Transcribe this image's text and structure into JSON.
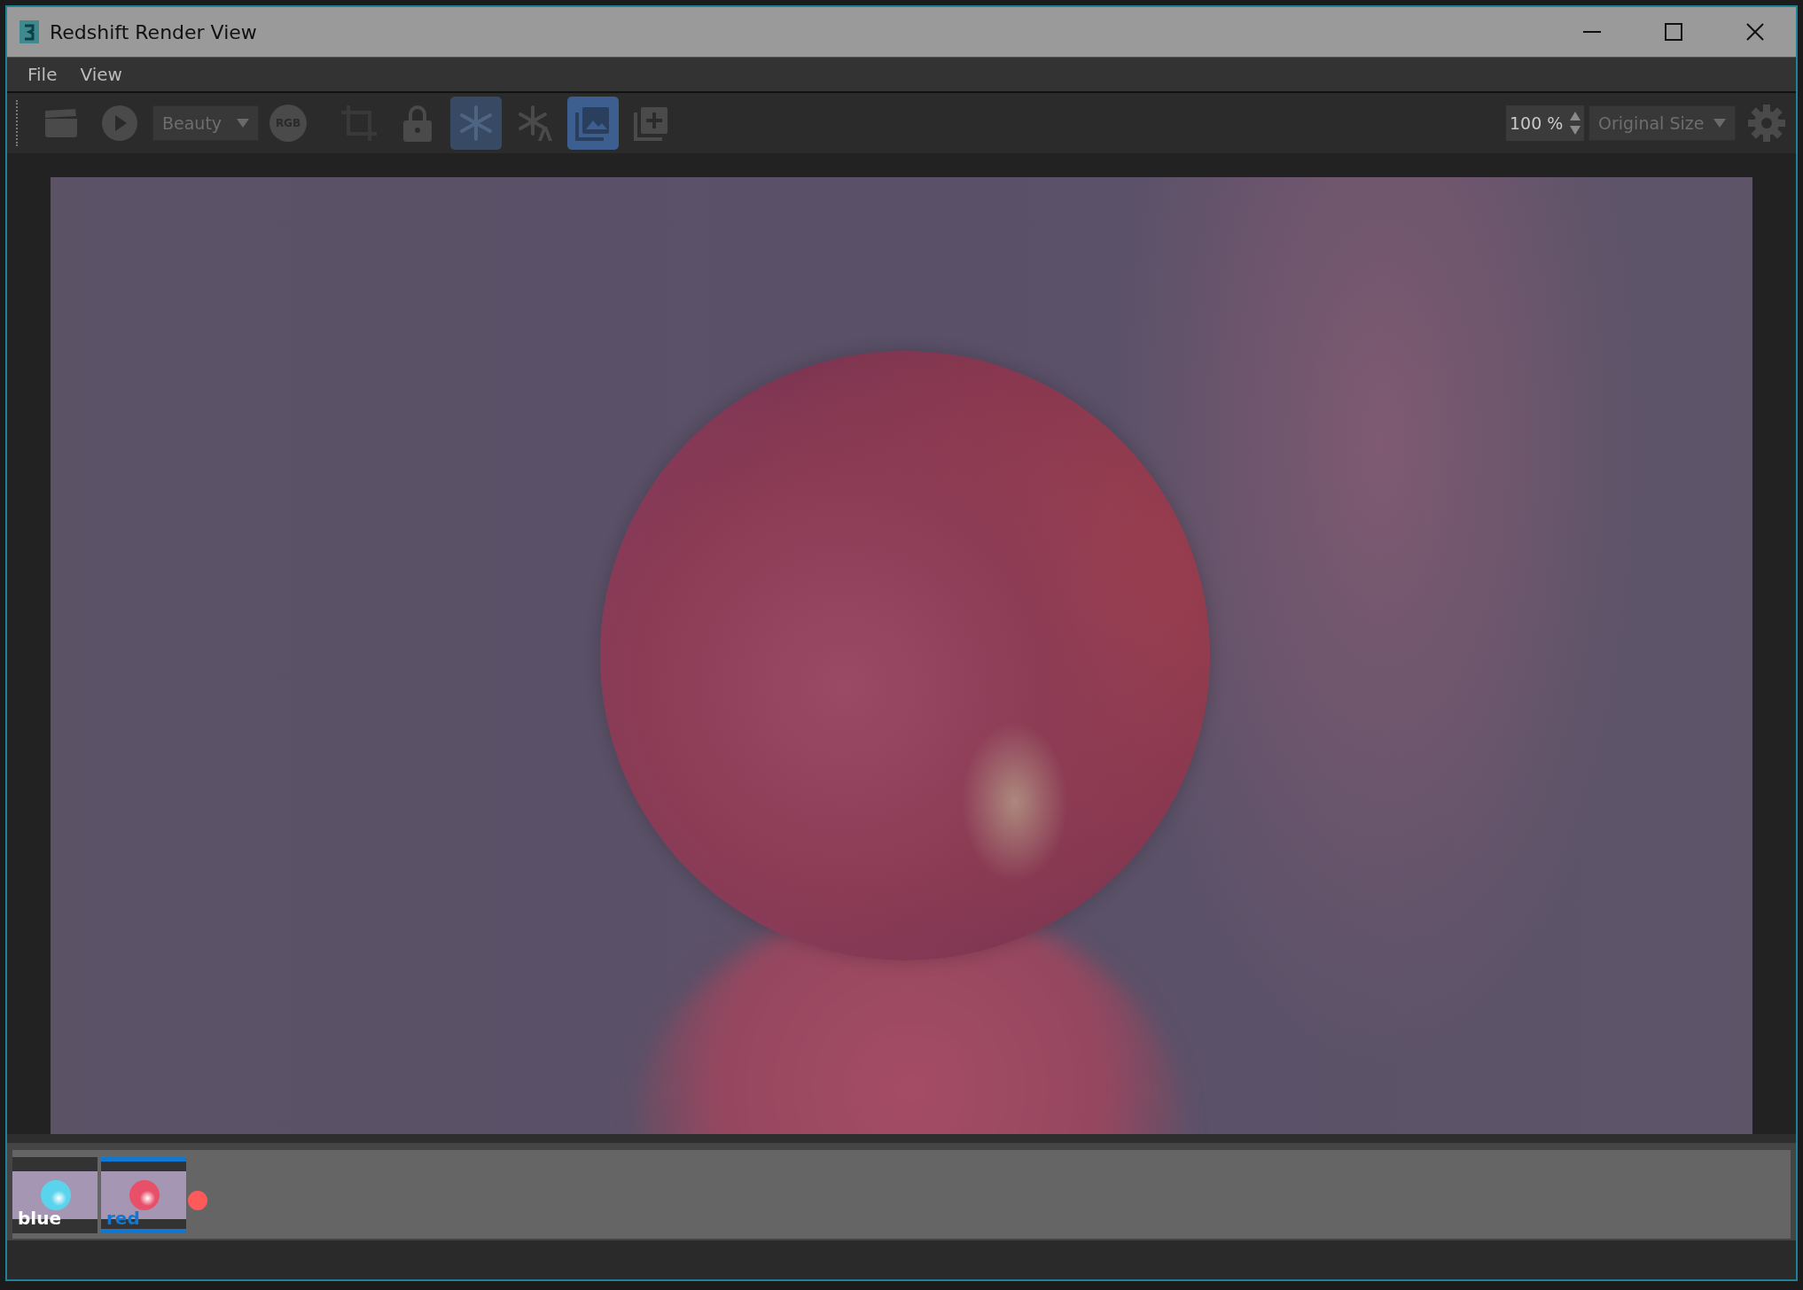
{
  "window": {
    "title": "Redshift Render View"
  },
  "menu": [
    {
      "label": "File"
    },
    {
      "label": "View"
    }
  ],
  "toolbar": {
    "tools": [
      {
        "kind": "clapper",
        "on": false,
        "disabled": false
      },
      {
        "kind": "play",
        "on": false,
        "disabled": false
      },
      {
        "kind": "dropdown",
        "label": "Beauty"
      },
      {
        "kind": "rgb",
        "label": "RGB",
        "on": false,
        "disabled": false
      },
      {
        "kind": "crop",
        "on": false,
        "disabled": true
      },
      {
        "kind": "lock",
        "on": false,
        "disabled": false
      },
      {
        "kind": "snowflake",
        "on": true,
        "disabled": false
      },
      {
        "kind": "snowflake-a",
        "on": false,
        "disabled": false
      },
      {
        "kind": "snapshots",
        "on": true,
        "disabled": false
      },
      {
        "kind": "add",
        "on": false,
        "disabled": false
      }
    ],
    "zoom": {
      "value": "100 %"
    },
    "size": {
      "label": "Original Size"
    }
  },
  "snapshots": [
    {
      "label": "blue",
      "selected": false,
      "flagged": false,
      "color": "#5ad4ec"
    },
    {
      "label": "red",
      "selected": true,
      "flagged": true,
      "color": "#e8506a"
    }
  ]
}
